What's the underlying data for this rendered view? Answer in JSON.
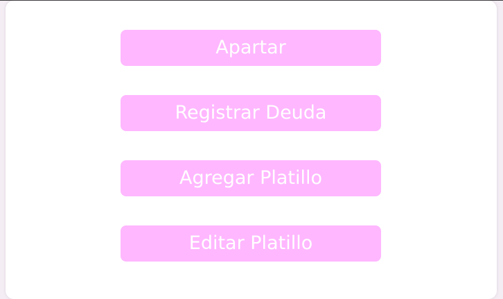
{
  "colors": {
    "button_background": "#ffb7ff",
    "button_text": "#ffffff",
    "card_background": "#ffffff",
    "page_background": "#f4eef4"
  },
  "buttons": [
    {
      "label": "Apartar"
    },
    {
      "label": "Registrar Deuda"
    },
    {
      "label": "Agregar Platillo"
    },
    {
      "label": "Editar Platillo"
    }
  ]
}
